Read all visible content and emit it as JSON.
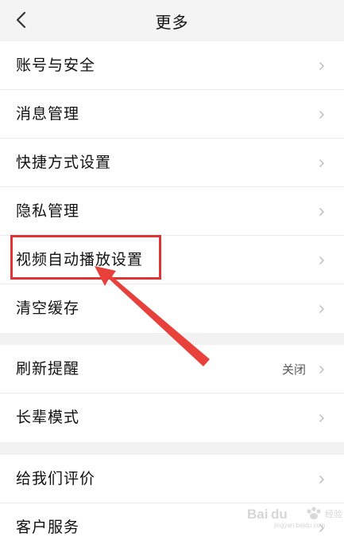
{
  "header": {
    "title": "更多"
  },
  "sections": [
    {
      "items": [
        {
          "label": "账号与安全"
        },
        {
          "label": "消息管理"
        },
        {
          "label": "快捷方式设置"
        },
        {
          "label": "隐私管理"
        },
        {
          "label": "视频自动播放设置"
        },
        {
          "label": "清空缓存"
        }
      ]
    },
    {
      "items": [
        {
          "label": "刷新提醒",
          "value": "关闭"
        },
        {
          "label": "长辈模式"
        }
      ]
    },
    {
      "items": [
        {
          "label": "给我们评价"
        },
        {
          "label": "客户服务"
        }
      ]
    }
  ],
  "annotation": {
    "highlight_color": "#e03434"
  },
  "watermark": {
    "brand": "Baidu",
    "sub": "jingyan.baidu.com"
  },
  "icons": {
    "back": "chevron-left-icon",
    "row_arrow": "chevron-right-icon"
  }
}
